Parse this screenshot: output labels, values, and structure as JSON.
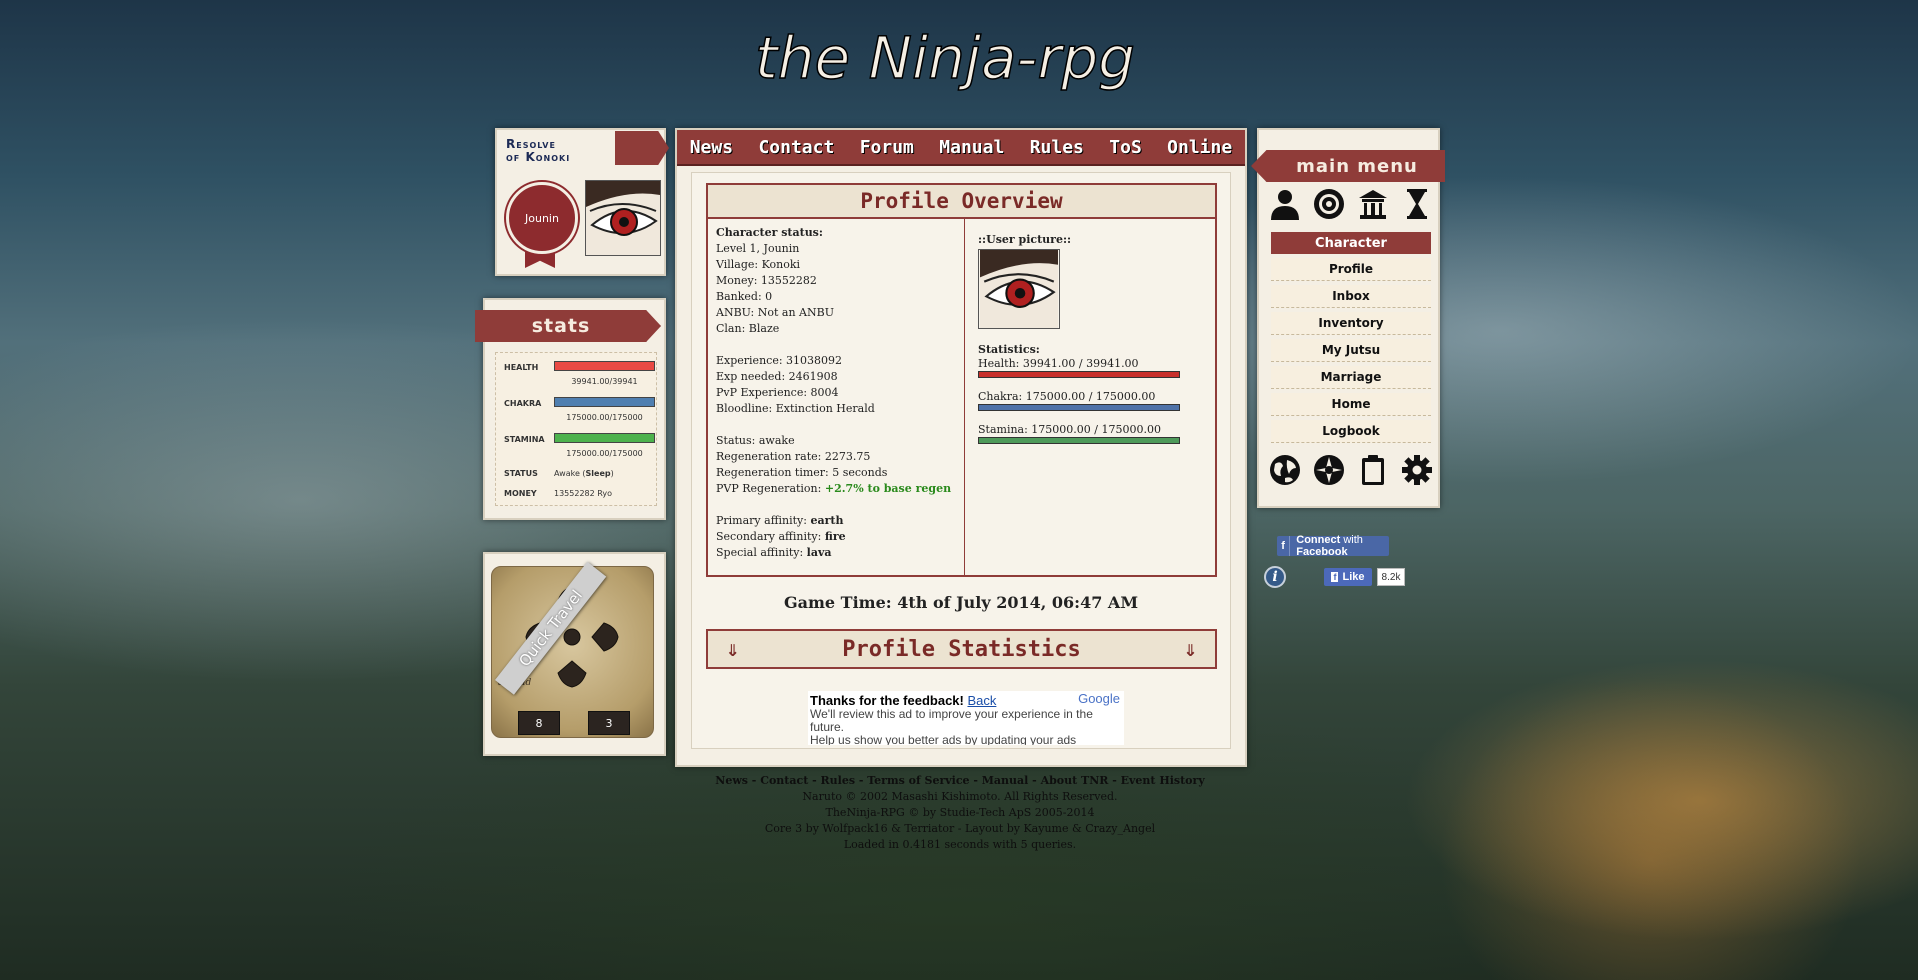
{
  "logo": {
    "text": "the Ninja-rpg"
  },
  "user": {
    "title_line1": "Resolve",
    "title_line2": "of Konoki",
    "rank": "Jounin"
  },
  "stats": {
    "title": "stats",
    "health_label": "HEALTH",
    "health_value": "39941.00/39941",
    "health_fraction": 1.0,
    "chakra_label": "CHAKRA",
    "chakra_value": "175000.00/175000",
    "chakra_fraction": 1.0,
    "stamina_label": "STAMINA",
    "stamina_value": "175000.00/175000",
    "stamina_fraction": 1.0,
    "status_label": "STATUS",
    "status_value": "Awake (",
    "status_link": "Sleep",
    "status_close": ")",
    "money_label": "MONEY",
    "money_value": "13552282 Ryo",
    "colors": {
      "health": "#e94a44",
      "chakra": "#4f7fb0",
      "stamina": "#4db24d"
    }
  },
  "quick_travel": {
    "label": "Quick Travel",
    "map_label": "Shroud",
    "coord_x": "8",
    "coord_y": "3"
  },
  "nav": [
    "News",
    "Contact",
    "Forum",
    "Manual",
    "Rules",
    "ToS",
    "Online"
  ],
  "profile": {
    "heading": "Profile Overview",
    "character_status_label": "Character status:",
    "level": "Level 1, Jounin",
    "village": "Village: Konoki",
    "money": "Money: 13552282",
    "banked": "Banked: 0",
    "anbu": "ANBU: Not an ANBU",
    "clan": "Clan: Blaze",
    "experience": "Experience: 31038092",
    "exp_needed": "Exp needed: 2461908",
    "pvp_experience": "PvP Experience: 8004",
    "bloodline": "Bloodline: Extinction Herald",
    "status": "Status: awake",
    "regen_rate": "Regeneration rate: 2273.75",
    "regen_timer": "Regeneration timer: 5 seconds",
    "pvp_regen_label": "PVP Regeneration: ",
    "pvp_regen_value": "+2.7% to base regen",
    "primary_affinity_label": "Primary affinity: ",
    "primary_affinity": "earth",
    "secondary_affinity_label": "Secondary affinity: ",
    "secondary_affinity": "fire",
    "special_affinity_label": "Special affinity: ",
    "special_affinity": "lava",
    "user_picture_label": "::User picture::",
    "statistics_label": "Statistics:",
    "health": "Health: 39941.00 / 39941.00",
    "chakra": "Chakra: 175000.00 / 175000.00",
    "stamina": "Stamina: 175000.00 / 175000.00",
    "health_fraction": 1.0,
    "chakra_fraction": 1.0,
    "stamina_fraction": 1.0,
    "bar_colors": {
      "health": "#c8302c",
      "chakra": "#4f72a8",
      "stamina": "#4e9a5a"
    }
  },
  "game_time": "Game Time: 4th of July 2014, 06:47 AM",
  "profile_statistics": {
    "heading": "Profile Statistics",
    "arrow": "⇓"
  },
  "ad": {
    "title": "Thanks for the feedback! ",
    "back": "Back",
    "brand": "Google",
    "line1": "We'll review this ad to improve your experience in the",
    "line2": "future.",
    "line3": "Help us show you better ads by updating your ads"
  },
  "footer": {
    "links": "News - Contact - Rules - Terms of Service - Manual - About TNR - Event History",
    "line1": "Naruto © 2002 Masashi Kishimoto. All Rights Reserved.",
    "line2": "TheNinja-RPG © by Studie-Tech ApS 2005-2014",
    "line3": "Core 3 by Wolfpack16 & Terriator - Layout by Kayume & Crazy_Angel",
    "line4": "Loaded in 0.4181 seconds with 5 queries."
  },
  "menu": {
    "title": "main menu",
    "category": "Character",
    "items": [
      "Profile",
      "Inbox",
      "Inventory",
      "My Jutsu",
      "Marriage",
      "Home",
      "Logbook"
    ],
    "top_icons": [
      "person-icon",
      "target-icon",
      "temple-icon",
      "hourglass-icon"
    ],
    "bottom_icons": [
      "globe-icon",
      "orb-icon",
      "clipboard-icon",
      "gear-icon"
    ]
  },
  "facebook": {
    "connect_prefix": "Connect",
    "connect_with": " with ",
    "connect_brand": "Facebook",
    "like": "Like",
    "like_count": "8.2k"
  }
}
